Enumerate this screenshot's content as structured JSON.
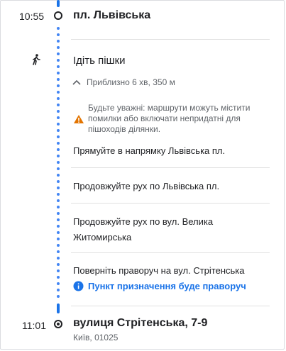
{
  "start": {
    "time": "10:55",
    "name": "пл. Львівська"
  },
  "walk": {
    "title": "Ідіть пішки",
    "summary": "Приблизно 6 хв, 350 м",
    "warning": [
      "Будьте уважні: маршрути можуть містити",
      "помилки або включати непридатні для",
      "пішоходів ділянки."
    ]
  },
  "steps": [
    {
      "line1": "Прямуйте в напрямку Львівська пл."
    },
    {
      "line1": "Продовжуйте рух по Львівська пл."
    },
    {
      "line1": "Продовжуйте рух по вул. Велика",
      "line2": "Житомирська"
    },
    {
      "line1": "Поверніть праворуч на вул. Стрітенська"
    }
  ],
  "destination_note": "Пункт призначення буде праворуч",
  "end": {
    "time": "11:01",
    "name": "вулиця Стрітенська, 7-9",
    "address": "Київ, 01025"
  },
  "icons": {
    "walk": "walking-person-icon",
    "expand": "chevron-up-icon",
    "warning": "warning-triangle-icon",
    "info": "info-icon"
  },
  "colors": {
    "accent": "#1a73e8",
    "warning": "#e37400"
  }
}
